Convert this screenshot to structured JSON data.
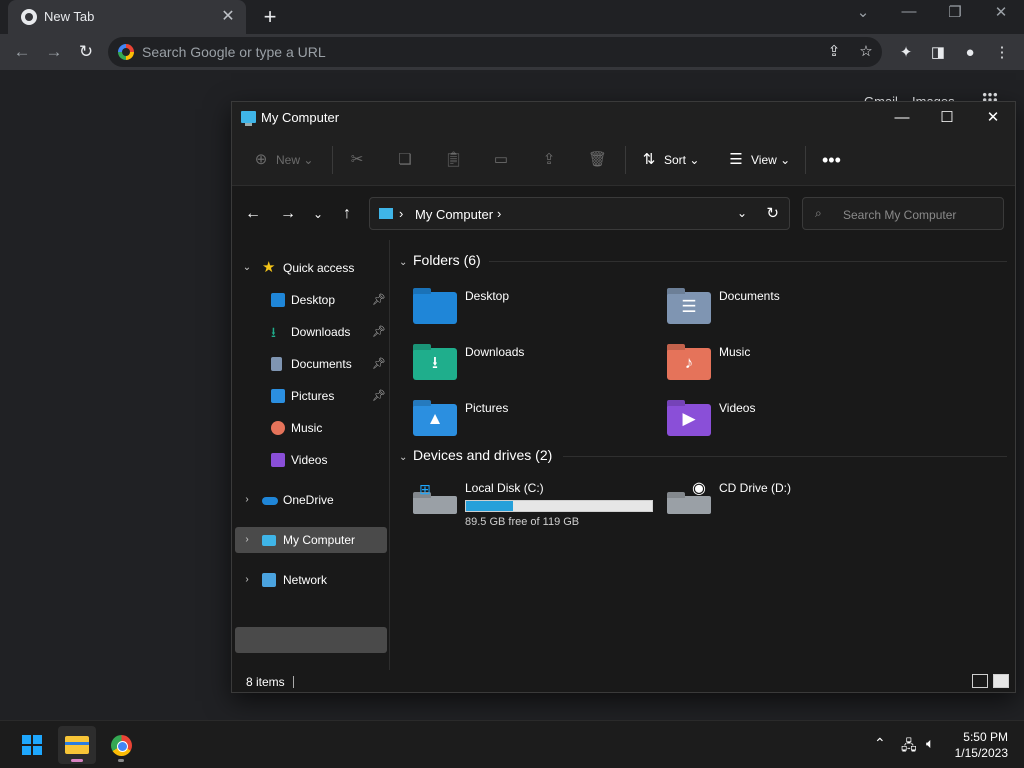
{
  "chrome": {
    "tab_title": "New Tab",
    "omnibox_placeholder": "Search Google or type a URL",
    "gmail": "Gmail",
    "images": "Images"
  },
  "explorer": {
    "title": "My Computer",
    "commands": {
      "new": "New",
      "sort": "Sort",
      "view": "View"
    },
    "address_path": "My Computer",
    "search_placeholder": "Search My Computer",
    "nav": {
      "quick_access": "Quick access",
      "quick_items": [
        {
          "label": "Desktop",
          "pinned": true
        },
        {
          "label": "Downloads",
          "pinned": true
        },
        {
          "label": "Documents",
          "pinned": true
        },
        {
          "label": "Pictures",
          "pinned": true
        },
        {
          "label": "Music",
          "pinned": false
        },
        {
          "label": "Videos",
          "pinned": false
        }
      ],
      "onedrive": "OneDrive",
      "my_computer": "My Computer",
      "network": "Network"
    },
    "folders_header": "Folders (6)",
    "folders": [
      {
        "name": "Desktop",
        "color": "#1f86d8"
      },
      {
        "name": "Documents",
        "color": "#7f95b2"
      },
      {
        "name": "Downloads",
        "color": "#1fae8c"
      },
      {
        "name": "Music",
        "color": "#e5735a"
      },
      {
        "name": "Pictures",
        "color": "#2b8fe0"
      },
      {
        "name": "Videos",
        "color": "#8a4fd8"
      }
    ],
    "drives_header": "Devices and drives (2)",
    "drives": [
      {
        "name": "Local Disk (C:)",
        "free_text": "89.5 GB free of 119 GB",
        "used_fraction": 0.25
      },
      {
        "name": "CD Drive (D:)"
      }
    ],
    "status": "8 items"
  },
  "taskbar": {
    "time": "5:50 PM",
    "date": "1/15/2023"
  }
}
